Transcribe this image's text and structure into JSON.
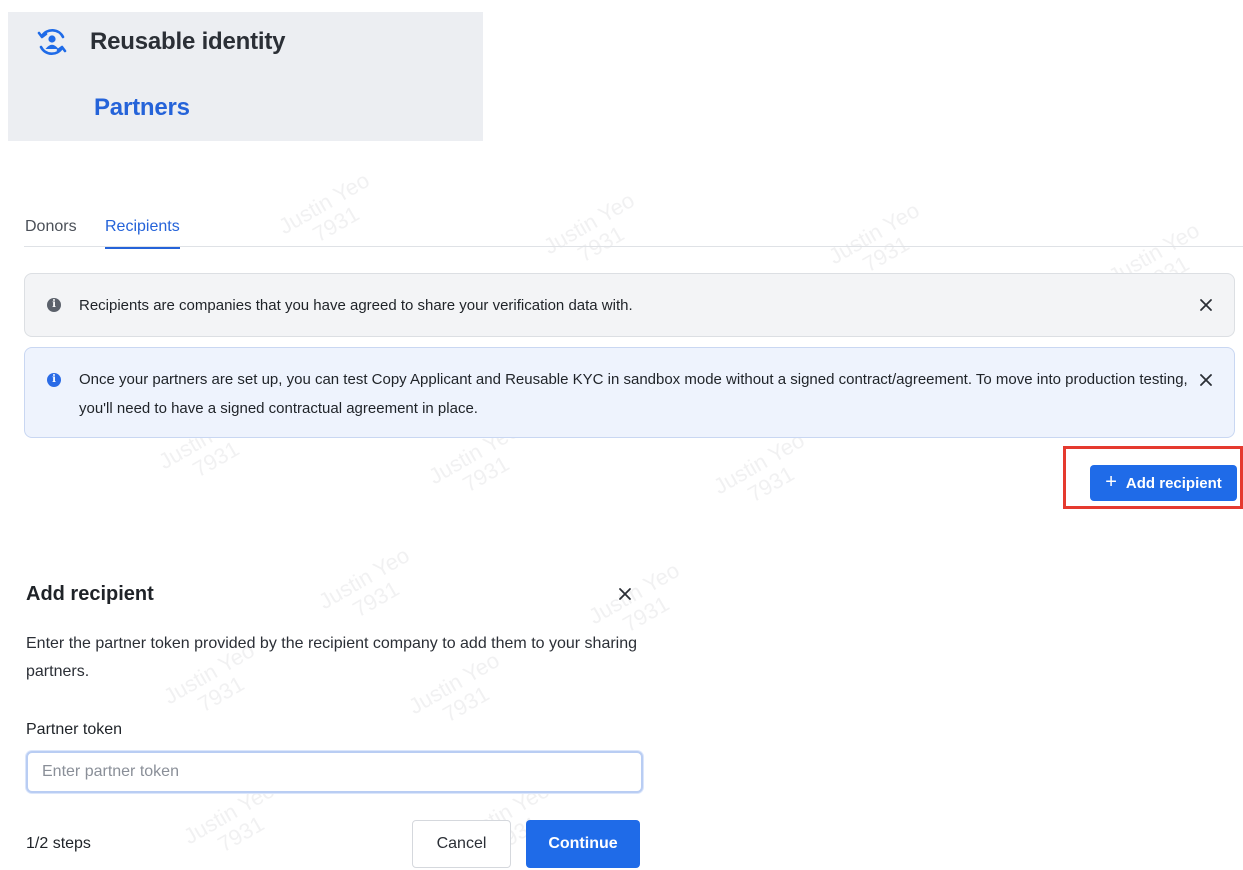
{
  "nav": {
    "title": "Reusable identity",
    "subtitle": "Partners",
    "icon": "reusable-identity-icon"
  },
  "tabs": [
    {
      "label": "Donors",
      "active": false
    },
    {
      "label": "Recipients",
      "active": true
    }
  ],
  "banners": {
    "info_gray": "Recipients are companies that you have agreed to share your verification data with.",
    "info_blue": "Once your partners are set up, you can test Copy Applicant and Reusable KYC in sandbox mode without a signed contract/agreement. To move into production testing, you'll need to have a signed contractual agreement in place."
  },
  "actions": {
    "add_recipient_label": "Add recipient"
  },
  "modal": {
    "title": "Add recipient",
    "description": "Enter the partner token provided by the recipient company to add them to your sharing partners.",
    "field_label": "Partner token",
    "field_placeholder": "Enter partner token",
    "field_value": "",
    "steps": "1/2 steps",
    "cancel_label": "Cancel",
    "continue_label": "Continue"
  },
  "watermark": {
    "name": "Justin Yeo",
    "id": "7931"
  },
  "colors": {
    "accent": "#1f6be8",
    "highlight": "#e53a2f",
    "nav_bg": "#eceef2",
    "info_blue_bg": "#eef3fd"
  }
}
